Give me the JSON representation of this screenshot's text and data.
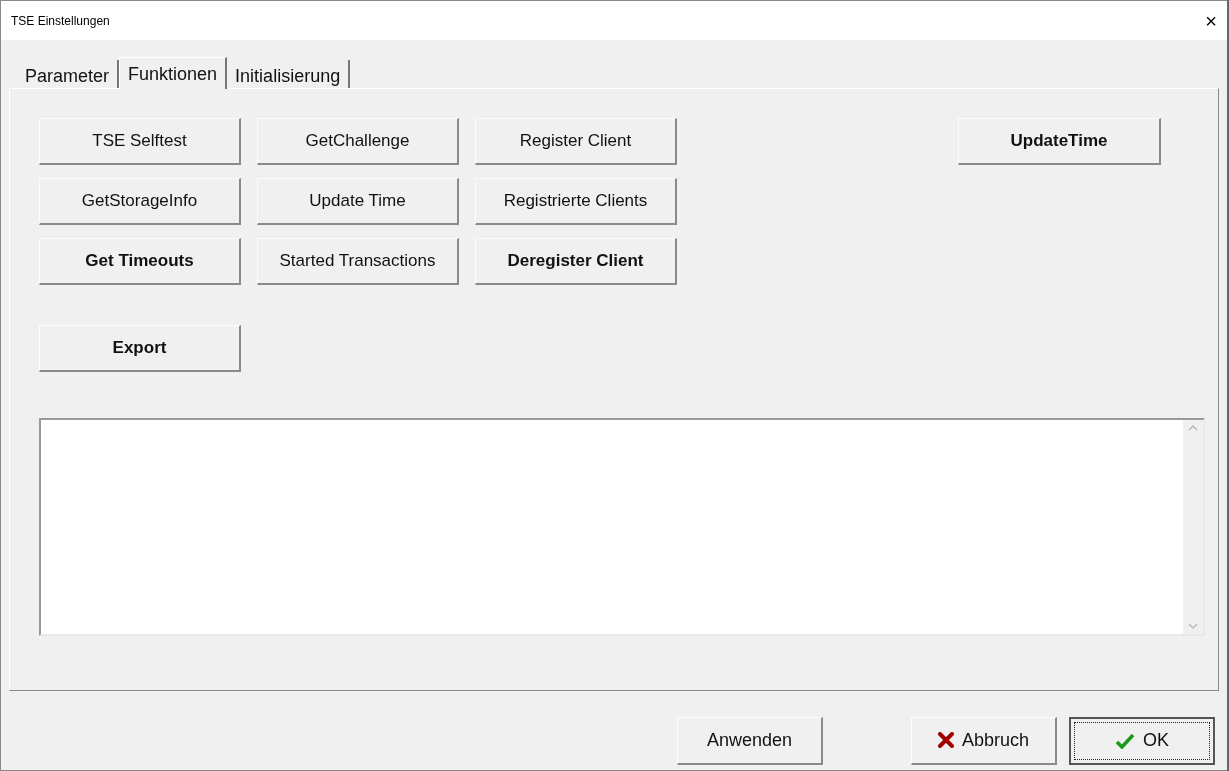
{
  "window": {
    "title": "TSE Einstellungen",
    "close": "×"
  },
  "tabs": [
    {
      "label": "Parameter",
      "selected": false
    },
    {
      "label": "Funktionen",
      "selected": true
    },
    {
      "label": "Initialisierung",
      "selected": false
    }
  ],
  "function_buttons": [
    {
      "label": "TSE Selftest",
      "emphasis": false
    },
    {
      "label": "GetChallenge",
      "emphasis": false
    },
    {
      "label": "Register Client",
      "emphasis": false
    },
    {
      "label": "GetStorageInfo",
      "emphasis": false
    },
    {
      "label": "Update Time",
      "emphasis": false
    },
    {
      "label": "Registrierte Clients",
      "emphasis": false
    },
    {
      "label": "Get Timeouts",
      "emphasis": true
    },
    {
      "label": "Started Transactions",
      "emphasis": false
    },
    {
      "label": "Deregister Client",
      "emphasis": true
    }
  ],
  "export_button": {
    "label": "Export",
    "emphasis": true
  },
  "update_time_button": {
    "label": "UpdateTime",
    "emphasis": true
  },
  "footer_buttons": [
    {
      "label": "Anwenden",
      "kind": "plain",
      "default": false
    },
    {
      "label": "Abbruch",
      "kind": "cancel",
      "default": false
    },
    {
      "label": "OK",
      "kind": "ok",
      "default": true
    }
  ]
}
